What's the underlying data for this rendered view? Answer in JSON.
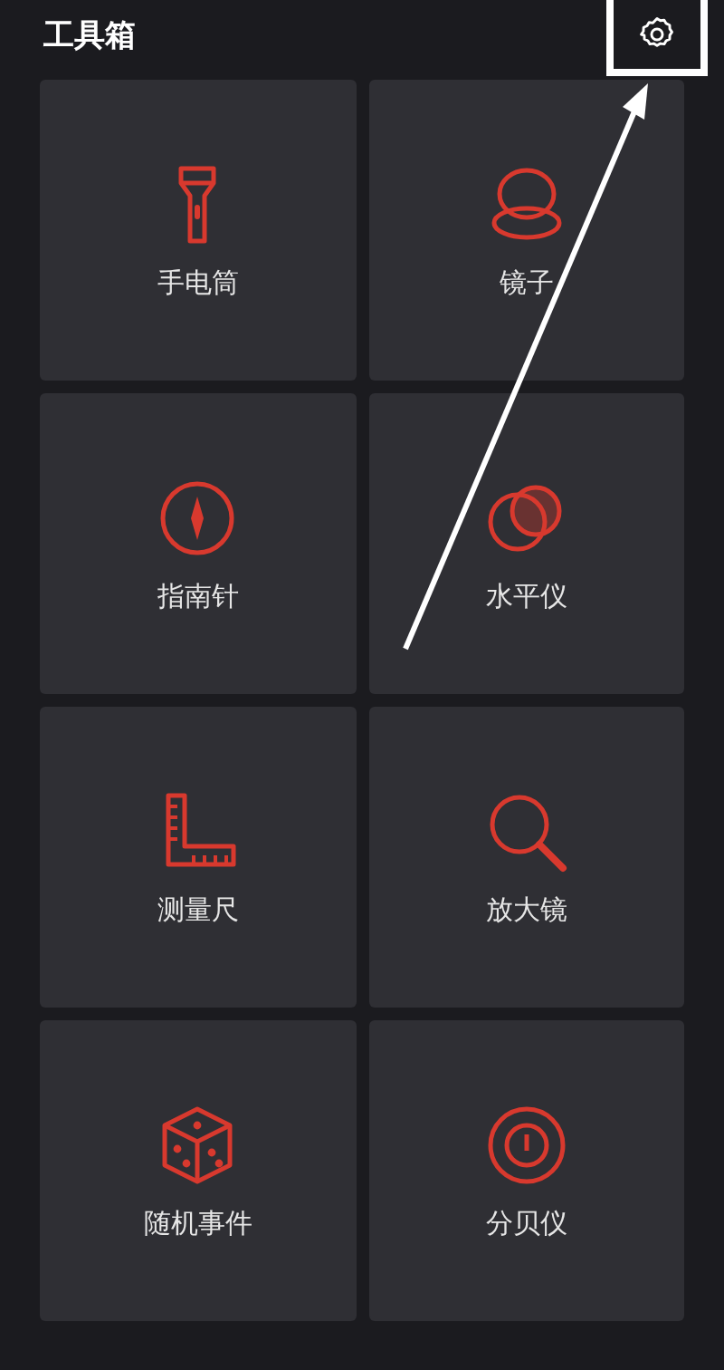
{
  "header": {
    "title": "工具箱"
  },
  "tools": [
    {
      "label": "手电筒"
    },
    {
      "label": "镜子"
    },
    {
      "label": "指南针"
    },
    {
      "label": "水平仪"
    },
    {
      "label": "测量尺"
    },
    {
      "label": "放大镜"
    },
    {
      "label": "随机事件"
    },
    {
      "label": "分贝仪"
    }
  ]
}
